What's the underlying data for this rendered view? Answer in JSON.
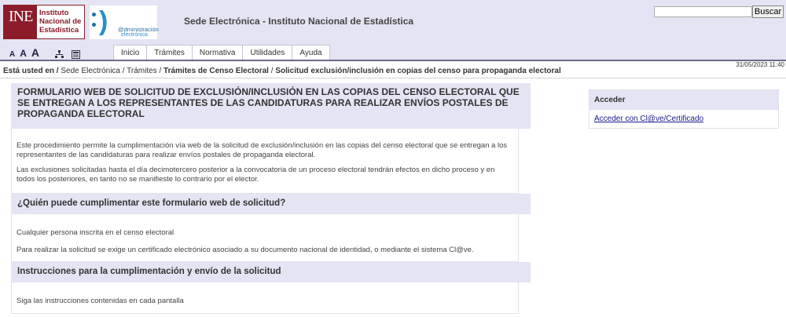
{
  "header": {
    "ine_logo": {
      "mark": "INE",
      "name_lines": [
        "Instituto",
        "Nacional de",
        "Estadística"
      ]
    },
    "admin_logo": {
      "line1": "@dministración",
      "line2": "electrónica"
    },
    "title": "Sede Electrónica - Instituto Nacional de Estadística",
    "search": {
      "placeholder": "",
      "button_label": "Buscar"
    },
    "font_sizes": [
      "A",
      "A",
      "A"
    ],
    "icons": [
      "site-tree-icon",
      "site-map-icon"
    ]
  },
  "nav": {
    "tabs": [
      "Inicio",
      "Trámites",
      "Normativa",
      "Utilidades",
      "Ayuda"
    ]
  },
  "date": "31/05/2023 11:40",
  "breadcrumb": {
    "prefix": "Está usted en",
    "items": [
      "Sede Electrónica",
      "Trámites",
      "Trámites de Censo Electoral",
      "Solicitud exclusión/inclusión en copias del censo para propaganda electoral"
    ]
  },
  "main": {
    "title": "FORMULARIO WEB DE SOLICITUD DE EXCLUSIÓN/INCLUSIÓN EN LAS COPIAS DEL CENSO ELECTORAL QUE SE ENTREGAN A LOS REPRESENTANTES DE LAS CANDIDATURAS PARA REALIZAR ENVÍOS POSTALES DE PROPAGANDA ELECTORAL",
    "intro": [
      "Este procedimiento permite la cumplimentación vía web de la solicitud de exclusión/inclusión en las copias del censo electoral que se entregan a los representantes de las candidaturas para realizar envíos postales de propaganda electoral.",
      "Las exclusiones solicitadas hasta el día decimotercero posterior a la convocatoria de un proceso electoral tendrán efectos en dicho proceso y en todos los posteriores, en tanto no se manifieste lo contrario por el elector."
    ],
    "who": {
      "heading": "¿Quién puede cumplimentar este formulario web de solicitud?",
      "lines": [
        "Cualquier persona inscrita en el censo electoral",
        "Para realizar la solicitud se exige un certificado electrónico asociado a su documento nacional de identidad, o mediante el sistema Cl@ve."
      ]
    },
    "instructions": {
      "heading": "Instrucciones para la cumplimentación y envío de la solicitud",
      "lines": [
        "Siga las instrucciones contenidas en cada pantalla"
      ]
    }
  },
  "sidebar": {
    "access_title": "Acceder",
    "access_link": "Acceder con Cl@ve/Certificado"
  }
}
